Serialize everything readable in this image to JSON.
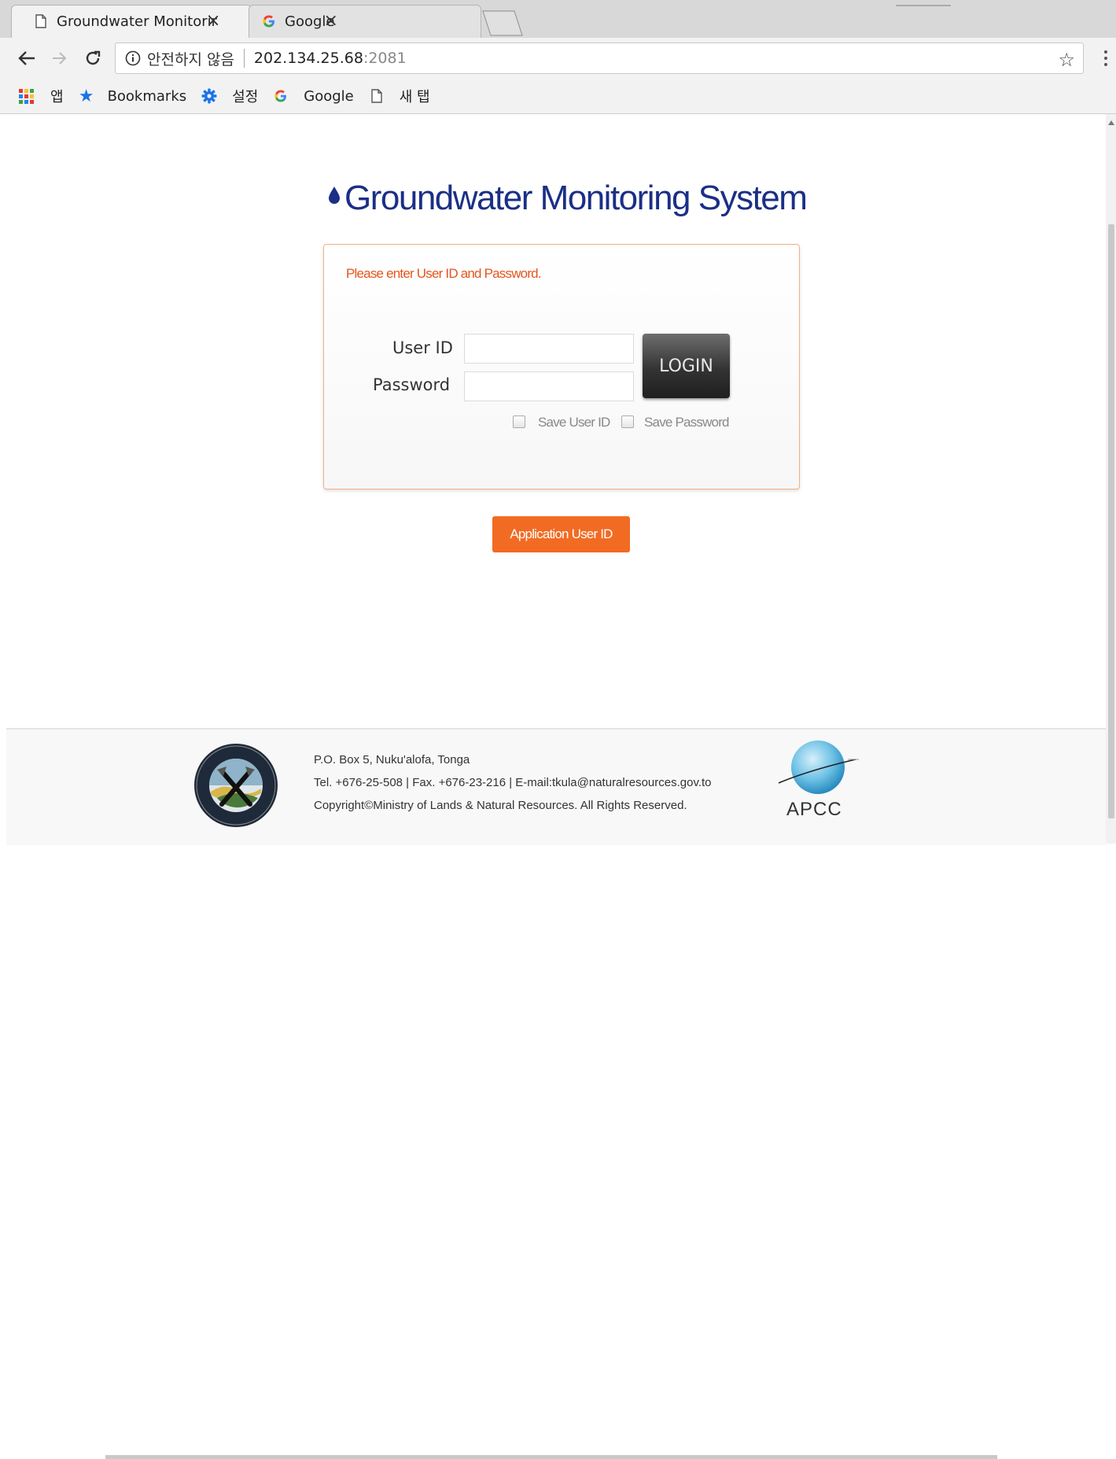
{
  "browser": {
    "tabs": [
      {
        "title": "Groundwater Monitoring",
        "icon": "page-icon",
        "active": true
      },
      {
        "title": "Google",
        "icon": "google-icon",
        "active": false
      }
    ],
    "close_glyph": "×",
    "address": {
      "security_label": "안전하지 않음",
      "url_host": "202.134.25.68",
      "url_port": ":2081"
    },
    "bookmarks": [
      {
        "label": "앱",
        "icon": "apps-icon"
      },
      {
        "label": "Bookmarks",
        "icon": "star-icon"
      },
      {
        "label": "설정",
        "icon": "gear-icon"
      },
      {
        "label": "Google",
        "icon": "google-icon"
      },
      {
        "label": "새 탭",
        "icon": "page-icon"
      }
    ]
  },
  "page": {
    "title": "Groundwater Monitoring System",
    "login": {
      "prompt": "Please enter User ID and Password.",
      "user_id_label": "User ID",
      "user_id_value": "",
      "password_label": "Password",
      "password_value": "",
      "login_button": "LOGIN",
      "save_user_id": "Save User ID",
      "save_password": "Save Password"
    },
    "apply_button": "Application User ID",
    "footer": {
      "address": "P.O. Box 5, Nuku'alofa, Tonga",
      "contact": "Tel. +676-25-508 | Fax. +676-23-216 | E-mail:tkula@naturalresources.gov.to",
      "copyright": "Copyright©Ministry of Lands & Natural Resources. All Rights Reserved.",
      "logo_right_text": "APCC"
    }
  },
  "colors": {
    "title_blue": "#1b2f86",
    "accent_orange": "#f26b22",
    "prompt_orange": "#e4551d"
  }
}
